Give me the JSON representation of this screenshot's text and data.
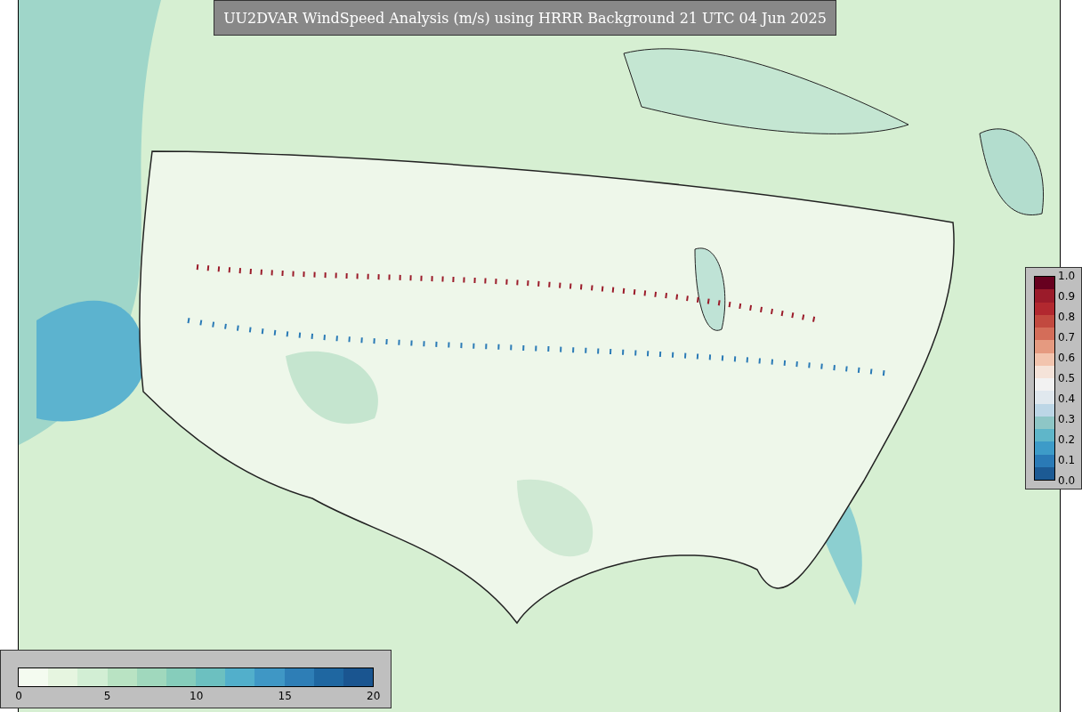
{
  "title": "UU2DVAR WindSpeed Analysis (m/s) using HRRR Background 21 UTC 04 Jun 2025",
  "ratio_colorbar": {
    "ticks": [
      "1.0",
      "0.9",
      "0.8",
      "0.7",
      "0.6",
      "0.5",
      "0.4",
      "0.3",
      "0.2",
      "0.1",
      "0.0"
    ]
  },
  "speed_colorbar": {
    "ticks": [
      "0",
      "5",
      "10",
      "15",
      "20"
    ]
  }
}
